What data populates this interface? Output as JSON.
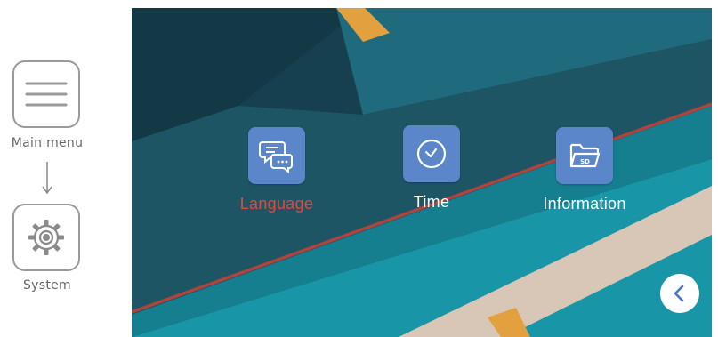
{
  "guide": {
    "step1_label": "Main menu",
    "step1_icon": "hamburger-menu-icon",
    "step2_label": "System",
    "step2_icon": "gear-icon"
  },
  "screen": {
    "items": [
      {
        "label": "Language",
        "icon": "chat-bubbles-icon",
        "selected": true
      },
      {
        "label": "Time",
        "icon": "clock-icon",
        "selected": false
      },
      {
        "label": "Information",
        "icon": "sd-folder-icon",
        "selected": false
      }
    ],
    "back_icon": "chevron-left-icon"
  },
  "colors": {
    "tile": "#5b86c9",
    "selected_text": "#e5473b",
    "label_text": "#ffffff",
    "back_chevron": "#4a78c8"
  }
}
